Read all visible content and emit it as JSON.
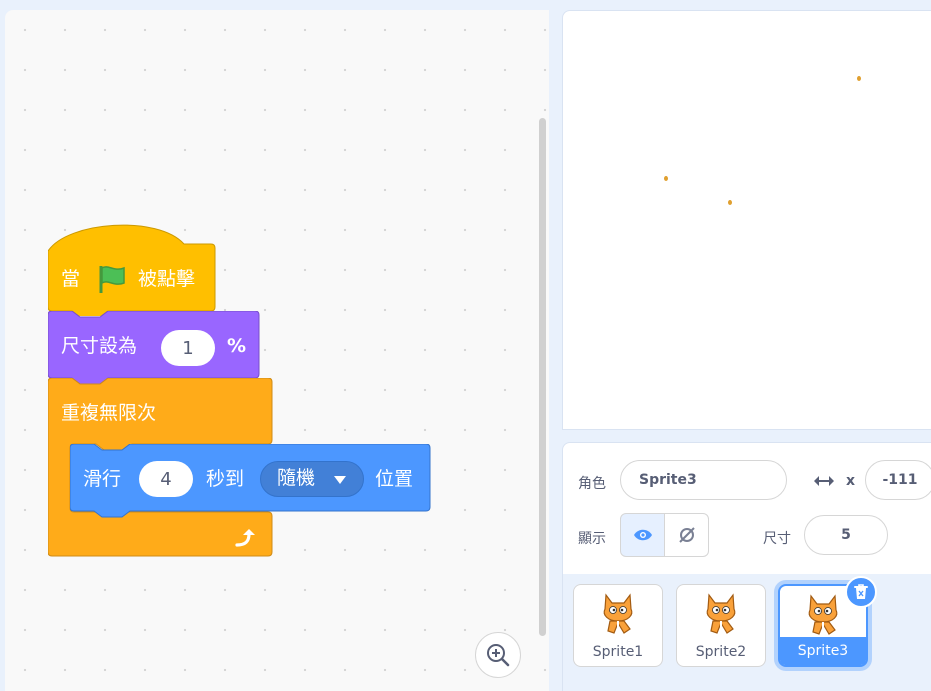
{
  "blocks": {
    "hat": {
      "prefix": "當",
      "suffix": "被點擊",
      "flag_icon": "green-flag-icon"
    },
    "set_size": {
      "label": "尺寸設為",
      "value": "1",
      "unit": "%"
    },
    "forever": {
      "label": "重複無限次",
      "loop_icon": "loop-arrow-icon"
    },
    "glide": {
      "prefix": "滑行",
      "seconds": "4",
      "middle": "秒到",
      "target": "隨機",
      "suffix": "位置"
    }
  },
  "colors": {
    "events": "#ffbf00",
    "looks": "#9966ff",
    "control": "#ffab19",
    "motion": "#4c97ff"
  },
  "workspace": {
    "zoom_icon": "zoom-in-icon"
  },
  "sprite_info": {
    "sprite_label": "角色",
    "sprite_name": "Sprite3",
    "x_label": "x",
    "x_value": "-111",
    "show_label": "顯示",
    "size_label": "尺寸",
    "size_value": "5"
  },
  "sprites": [
    {
      "name": "Sprite1",
      "selected": false
    },
    {
      "name": "Sprite2",
      "selected": false
    },
    {
      "name": "Sprite3",
      "selected": true
    }
  ]
}
